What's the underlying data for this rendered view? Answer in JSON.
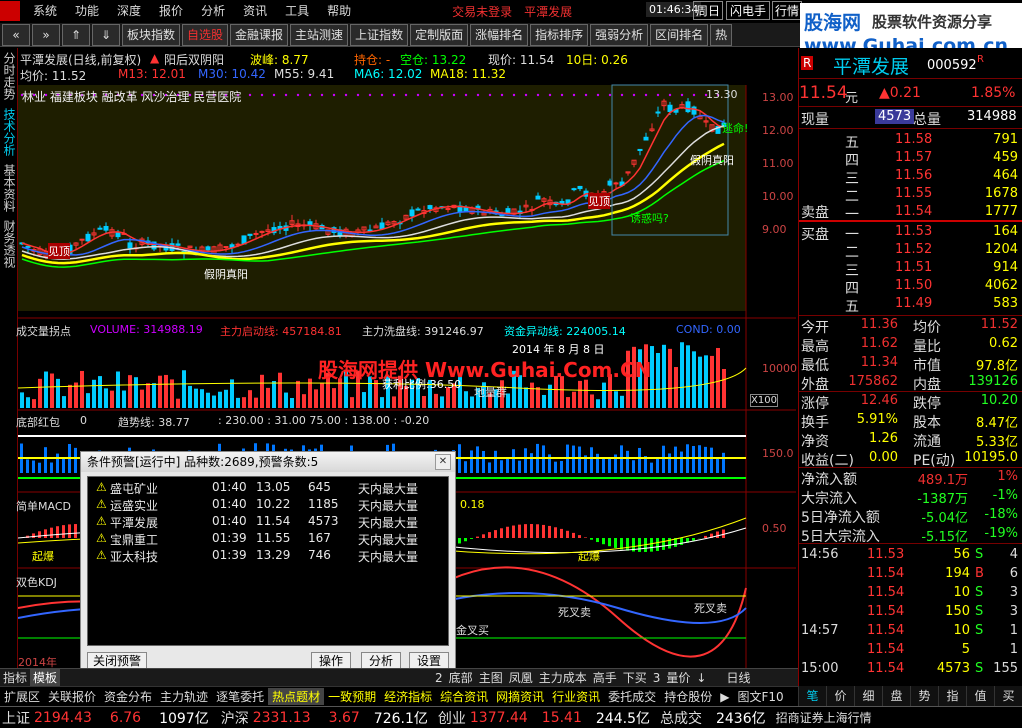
{
  "menu": {
    "items": [
      "系统",
      "功能",
      "深度",
      "报价",
      "分析",
      "资讯",
      "工具",
      "帮助"
    ],
    "status_red": "交易未登录",
    "stock_red": "平潭发展",
    "time": "01:46:34",
    "period": "周日",
    "flash": "闪电手",
    "quote": "行情"
  },
  "brand": {
    "name": "股海网",
    "tagline": "股票软件资源分享",
    "url": "www.Guhai.com.cn"
  },
  "toolbar": {
    "buttons": [
      "板块指数",
      "自选股",
      "金融课报",
      "主站测速",
      "上证指数",
      "定制版面",
      "涨幅排名",
      "指标排序",
      "强弱分析",
      "区间排名",
      "热"
    ],
    "selected": "自选股"
  },
  "lefttabs": [
    "分时走势",
    "技术分析",
    "基本资料",
    "财务透视"
  ],
  "chart_header": {
    "title": "平潭发展(日线,前复权)",
    "pattern": "阳后双阴阳",
    "wave": "波峰: 8.77",
    "hold": "持仓: -",
    "empty": "空仓: 13.22",
    "price": "现价: 11.54",
    "tenday": "10日: 0.26",
    "ma_avg": "均价: 11.52",
    "m13": "M13: 12.01",
    "m30": "M30: 10.42",
    "m55": "M55: 9.41",
    "ma6": "MA6: 12.02",
    "ma18": "MA18: 11.32",
    "concepts": "林业  福建板块 融改革 风沙治理 民营医院",
    "high_label": "13.30",
    "y_ticks": [
      "13.00",
      "12.00",
      "11.00",
      "10.00",
      "9.00"
    ],
    "annotations": {
      "see_top": "见顶",
      "escape": "逃命!",
      "fake_yin": "假阴真阳",
      "close_eye": "诱惑吗?"
    }
  },
  "volume_panel": {
    "label": "成交量拐点",
    "volume": "VOLUME: 314988.19",
    "main_start": "主力启动线: 457184.81",
    "main_wash": "主力洗盘线: 391246.97",
    "capital": "资金异动线: 224005.14",
    "cond": "COND: 0.00",
    "watermark": "股海网提供 Www.Guhai.Com.CN",
    "date": "2014 年 8 月 8 日",
    "profit": "获利比例:36.50",
    "dist": "地量群",
    "y_tick": "10000",
    "x100": "X100"
  },
  "bottom_red_panel": {
    "label": "底部红包",
    "val1": "0",
    "trend": "趋势线: 38.77",
    "vals": ": 230.00 : 31.00   75.00 : 138.00 : -0.20",
    "y_tick": "150.0"
  },
  "macd_panel": {
    "label": "简单MACD",
    "val": "0.18",
    "y_tick": "0.50",
    "tag_up": "起爆"
  },
  "kdj_panel": {
    "label": "双色KDJ",
    "sell": "死叉卖",
    "buy": "金叉买",
    "year": "2014年"
  },
  "dialog": {
    "title": "条件预警[运行中] 品种数:2689,预警条数:5",
    "rows": [
      {
        "name": "盛屯矿业",
        "time": "01:40",
        "price": "13.05",
        "vol": "645",
        "cond": "天内最大量"
      },
      {
        "name": "运盛实业",
        "time": "01:40",
        "price": "10.22",
        "vol": "1185",
        "cond": "天内最大量"
      },
      {
        "name": "平潭发展",
        "time": "01:40",
        "price": "11.54",
        "vol": "4573",
        "cond": "天内最大量"
      },
      {
        "name": "宝鼎重工",
        "time": "01:39",
        "price": "11.55",
        "vol": "167",
        "cond": "天内最大量"
      },
      {
        "name": "亚太科技",
        "time": "01:39",
        "price": "13.29",
        "vol": "746",
        "cond": "天内最大量"
      }
    ],
    "close_btn": "关闭预警",
    "op_btn": "操作",
    "anal_btn": "分析",
    "set_btn": "设置"
  },
  "navbar": {
    "items": [
      "指标",
      "模板",
      "",
      "",
      "",
      "",
      "",
      "",
      "",
      "",
      "2",
      "底部",
      "主图",
      "凤凰",
      "主力成本",
      "高手",
      "下买",
      "3",
      "量价",
      "↓",
      "日线"
    ],
    "selected": "模板"
  },
  "bottombar": {
    "items": [
      "扩展区",
      "关联报价",
      "资金分布",
      "主力轨迹",
      "逐笔委托",
      "热点题材",
      "一致预期",
      "经济指标",
      "综合资讯",
      "网摘资讯",
      "行业资讯",
      "委托成交",
      "持仓股份",
      "▶",
      "图文F10"
    ],
    "selected": "热点题材"
  },
  "rbtabs": {
    "items": [
      "笔",
      "价",
      "细",
      "盘",
      "势",
      "指",
      "值",
      "买"
    ],
    "selected": "笔"
  },
  "status": {
    "sh_label": "上证",
    "sh_val": "2194.43",
    "sh_chg": "6.76",
    "sh_amt": "1097亿",
    "hs_label": "沪深",
    "hs_val": "2331.13",
    "hs_chg": "3.67",
    "hs_amt": "726.1亿",
    "cy_label": "创业",
    "cy_val": "1377.44",
    "cy_chg": "15.41",
    "cy_amt": "244.5亿",
    "total_label": "总成交",
    "total_val": "2436亿",
    "broker": "招商证券上海行情"
  },
  "rpanel": {
    "tag": "R",
    "name": "平潭发展",
    "code": "000592",
    "r_mark": "R",
    "price": "11.54",
    "unit": "元",
    "change": "▲0.21",
    "pct": "1.85%",
    "now_label": "现量",
    "now_val": "4573",
    "total_label": "总量",
    "total_val": "314988",
    "sells": [
      {
        "label": "五",
        "price": "11.58",
        "vol": "791"
      },
      {
        "label": "四",
        "price": "11.57",
        "vol": "459"
      },
      {
        "label": "三",
        "price": "11.56",
        "vol": "464"
      },
      {
        "label": "二",
        "price": "11.55",
        "vol": "1678"
      },
      {
        "label": "一",
        "price": "11.54",
        "vol": "1777"
      }
    ],
    "sell_label": "卖盘",
    "buy_label": "买盘",
    "buys": [
      {
        "label": "一",
        "price": "11.53",
        "vol": "164"
      },
      {
        "label": "二",
        "price": "11.52",
        "vol": "1204"
      },
      {
        "label": "三",
        "price": "11.51",
        "vol": "914"
      },
      {
        "label": "四",
        "price": "11.50",
        "vol": "4062"
      },
      {
        "label": "五",
        "price": "11.49",
        "vol": "583"
      }
    ],
    "stats": [
      {
        "l1": "今开",
        "v1": "11.36",
        "c1": "#f03030",
        "l2": "均价",
        "v2": "11.52",
        "c2": "#f03030"
      },
      {
        "l1": "最高",
        "v1": "11.62",
        "c1": "#f03030",
        "l2": "量比",
        "v2": "0.62",
        "c2": "#ff0"
      },
      {
        "l1": "最低",
        "v1": "11.34",
        "c1": "#f03030",
        "l2": "市值",
        "v2": "97.8亿",
        "c2": "#ff0"
      },
      {
        "l1": "外盘",
        "v1": "175862",
        "c1": "#f03030",
        "l2": "内盘",
        "v2": "139126",
        "c2": "#2f2"
      }
    ],
    "stats2": [
      {
        "l1": "涨停",
        "v1": "12.46",
        "c1": "#f03030",
        "l2": "跌停",
        "v2": "10.20",
        "c2": "#2f2"
      },
      {
        "l1": "换手",
        "v1": "5.91%",
        "c1": "#ff0",
        "l2": "股本",
        "v2": "8.47亿",
        "c2": "#ff0"
      },
      {
        "l1": "净资",
        "v1": "1.26",
        "c1": "#ff0",
        "l2": "流通",
        "v2": "5.33亿",
        "c2": "#ff0"
      },
      {
        "l1": "收益(二)",
        "v1": "0.00",
        "c1": "#ff0",
        "l2": "PE(动)",
        "v2": "10195.0",
        "c2": "#ff0"
      }
    ],
    "flows": [
      {
        "label": "净流入额",
        "val": "489.1万",
        "pct": "1%",
        "c": "#f03030"
      },
      {
        "label": "大宗流入",
        "val": "-1387万",
        "pct": "-1%",
        "c": "#2f2"
      },
      {
        "label": "5日净流入额",
        "val": "-5.04亿",
        "pct": "-18%",
        "c": "#2f2"
      },
      {
        "label": "5日大宗流入",
        "val": "-5.15亿",
        "pct": "-19%",
        "c": "#2f2"
      }
    ],
    "ticks": [
      {
        "time": "14:56",
        "price": "11.53",
        "vol": "56",
        "bs": "S",
        "n": "4"
      },
      {
        "time": "",
        "price": "11.54",
        "vol": "194",
        "bs": "B",
        "n": "6"
      },
      {
        "time": "",
        "price": "11.54",
        "vol": "10",
        "bs": "S",
        "n": "3"
      },
      {
        "time": "",
        "price": "11.54",
        "vol": "150",
        "bs": "S",
        "n": "3"
      },
      {
        "time": "14:57",
        "price": "11.54",
        "vol": "10",
        "bs": "S",
        "n": "1"
      },
      {
        "time": "",
        "price": "11.54",
        "vol": "5",
        "bs": "",
        "n": "1"
      },
      {
        "time": "15:00",
        "price": "11.54",
        "vol": "4573",
        "bs": "S",
        "n": "155"
      }
    ]
  }
}
